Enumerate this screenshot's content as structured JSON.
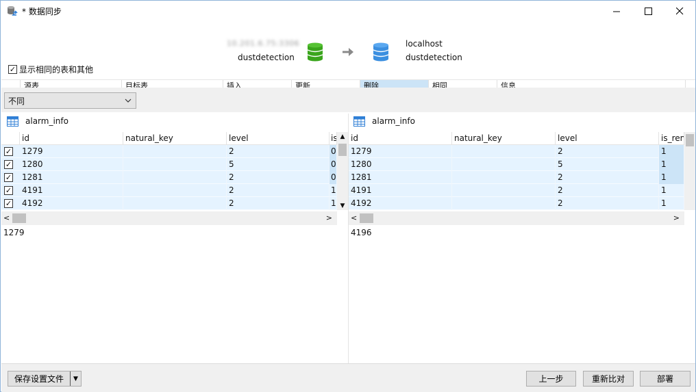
{
  "window": {
    "title": "* 数据同步",
    "minimize": "—",
    "maximize": "☐",
    "close": "✕"
  },
  "connection": {
    "source_host": "10.201.6.75:3306",
    "source_db": "dustdetection",
    "target_host": "localhost",
    "target_db": "dustdetection",
    "source_color": "#3aa51c",
    "target_color": "#3b8fe0"
  },
  "options": {
    "show_same_tables_label": "显示相同的表和其他",
    "show_same_tables_checked": true
  },
  "summary_columns": [
    "源表",
    "目标表",
    "插入",
    "更新",
    "删除",
    "相同",
    "信息"
  ],
  "filter": {
    "selected": "不同"
  },
  "left_pane": {
    "table_name": "alarm_info",
    "columns": [
      "id",
      "natural_key",
      "level",
      "is"
    ],
    "rows": [
      {
        "checked": true,
        "cells": [
          "1279",
          "",
          "2",
          "0"
        ]
      },
      {
        "checked": true,
        "cells": [
          "1280",
          "",
          "5",
          "0"
        ]
      },
      {
        "checked": true,
        "cells": [
          "1281",
          "",
          "2",
          "0"
        ]
      },
      {
        "checked": true,
        "cells": [
          "4191",
          "",
          "2",
          "1"
        ]
      },
      {
        "checked": true,
        "cells": [
          "4192",
          "",
          "2",
          "1"
        ]
      }
    ],
    "detail": "1279"
  },
  "right_pane": {
    "table_name": "alarm_info",
    "columns": [
      "id",
      "natural_key",
      "level",
      "is_ren"
    ],
    "rows": [
      {
        "cells": [
          "1279",
          "",
          "2",
          "1"
        ]
      },
      {
        "cells": [
          "1280",
          "",
          "5",
          "1"
        ]
      },
      {
        "cells": [
          "1281",
          "",
          "2",
          "1"
        ]
      },
      {
        "cells": [
          "4191",
          "",
          "2",
          "1"
        ]
      },
      {
        "cells": [
          "4192",
          "",
          "2",
          "1"
        ]
      }
    ],
    "detail": "4196"
  },
  "footer": {
    "save_settings": "保存设置文件",
    "prev": "上一步",
    "recompare": "重新比对",
    "deploy": "部署"
  }
}
